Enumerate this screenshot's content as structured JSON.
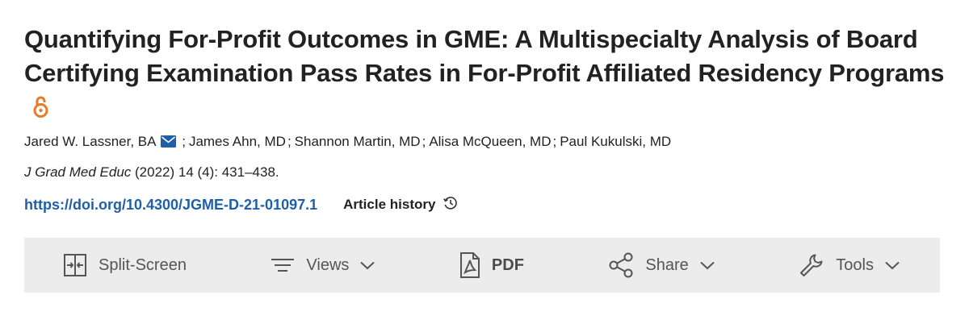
{
  "article": {
    "title": "Quantifying For-Profit Outcomes in GME: A Multispecialty Analysis of Board Certifying Examination Pass Rates in For-Profit Affiliated Residency Programs",
    "authors": [
      "Jared W. Lassner, BA",
      "James Ahn, MD",
      "Shannon Martin, MD",
      "Alisa McQueen, MD",
      "Paul Kukulski, MD"
    ],
    "author_separator": ";",
    "citation": {
      "journal": "J Grad Med Educ",
      "details": " (2022) 14 (4): 431–438."
    },
    "doi": "https://doi.org/10.4300/JGME-D-21-01097.1",
    "history_label": "Article history"
  },
  "toolbar": {
    "split_screen_label": "Split-Screen",
    "views_label": "Views",
    "pdf_label": "PDF",
    "share_label": "Share",
    "tools_label": "Tools"
  },
  "icons": {
    "open_access": "open-lock-icon",
    "email": "envelope-icon",
    "history": "clock-history-icon",
    "split_screen": "split-screen-icon",
    "views": "menu-lines-icon",
    "pdf": "pdf-file-icon",
    "share": "share-nodes-icon",
    "tools": "wrench-icon",
    "dropdown": "chevron-down-icon"
  },
  "colors": {
    "link": "#1f5fa8",
    "open_access": "#e87a2b",
    "email_icon": "#1f5fa8",
    "toolbar_bg": "#ececec",
    "toolbar_text": "#555555"
  }
}
